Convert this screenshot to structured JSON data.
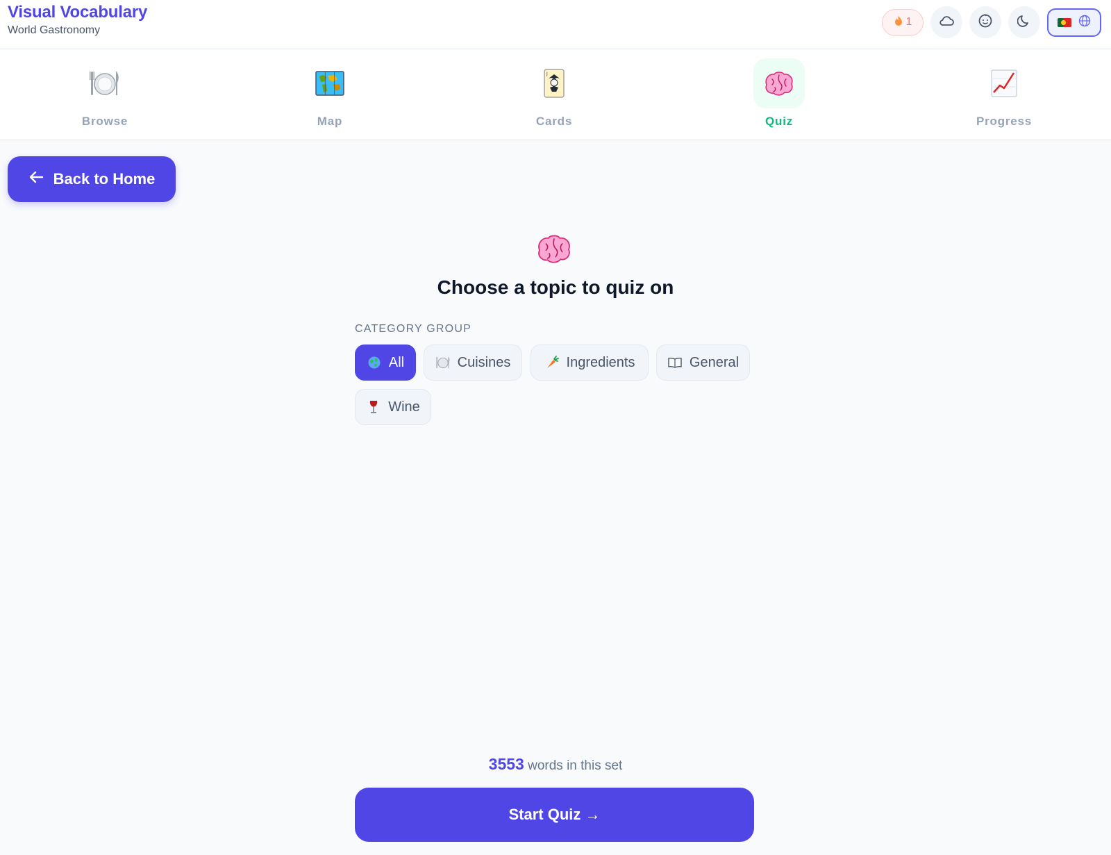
{
  "header": {
    "title": "Visual Vocabulary",
    "subtitle": "World Gastronomy",
    "streak_count": "1",
    "accent_color": "#4f46e5"
  },
  "nav": {
    "tabs": [
      {
        "label": "Browse",
        "icon": "plate-icon"
      },
      {
        "label": "Map",
        "icon": "world-map-icon"
      },
      {
        "label": "Cards",
        "icon": "joker-card-icon"
      },
      {
        "label": "Quiz",
        "icon": "brain-icon",
        "active": true
      },
      {
        "label": "Progress",
        "icon": "chart-increasing-icon"
      }
    ]
  },
  "back_button": {
    "label": "Back to Home"
  },
  "main": {
    "title": "Choose a topic to quiz on",
    "category_group_label": "CATEGORY GROUP",
    "chips": [
      {
        "label": "All",
        "icon": "globe-icon",
        "active": true
      },
      {
        "label": "Cuisines",
        "icon": "plate-icon"
      },
      {
        "label": "Ingredients",
        "icon": "carrot-icon"
      },
      {
        "label": "General",
        "icon": "book-icon"
      },
      {
        "label": "Wine",
        "icon": "wine-glass-icon"
      }
    ],
    "word_count": "3553",
    "word_count_suffix": "words in this set",
    "start_button": "Start Quiz →"
  }
}
